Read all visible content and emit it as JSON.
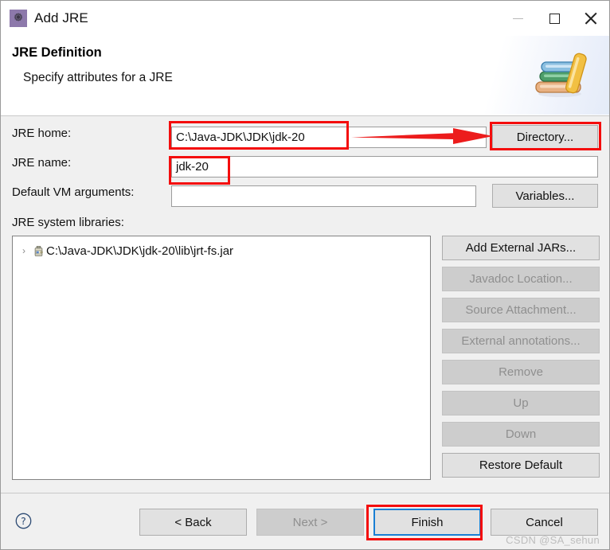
{
  "window": {
    "title": "Add JRE",
    "icon": "gear-icon",
    "controls": {
      "minimize": "—",
      "maximize": "□",
      "close": "✕"
    }
  },
  "banner": {
    "title": "JRE Definition",
    "description": "Specify attributes for a JRE",
    "image": "books-stack-image"
  },
  "form": {
    "jre_home": {
      "label": "JRE home:",
      "value": "C:\\Java-JDK\\JDK\\jdk-20",
      "placeholder": ""
    },
    "jre_name": {
      "label": "JRE name:",
      "value": "jdk-20",
      "placeholder": ""
    },
    "vm_args": {
      "label": "Default VM arguments:",
      "value": "",
      "placeholder": ""
    },
    "directory_button": "Directory...",
    "variables_button": "Variables..."
  },
  "libraries": {
    "label": "JRE system libraries:",
    "items": [
      {
        "text": "C:\\Java-JDK\\JDK\\jdk-20\\lib\\jrt-fs.jar",
        "icon": "jar-icon",
        "expander": "›"
      }
    ],
    "buttons": [
      {
        "label": "Add External JARs...",
        "enabled": true
      },
      {
        "label": "Javadoc Location...",
        "enabled": false
      },
      {
        "label": "Source Attachment...",
        "enabled": false
      },
      {
        "label": "External annotations...",
        "enabled": false
      },
      {
        "label": "Remove",
        "enabled": false
      },
      {
        "label": "Up",
        "enabled": false
      },
      {
        "label": "Down",
        "enabled": false
      },
      {
        "label": "Restore Default",
        "enabled": true
      }
    ]
  },
  "footer": {
    "help_icon": "help-question-icon",
    "back_label": "< Back",
    "next_label": "Next >",
    "finish_label": "Finish",
    "cancel_label": "Cancel",
    "next_enabled": false,
    "finish_focused": true,
    "watermark": "CSDN @SA_sehun"
  },
  "annotations": {
    "color": "#f40d0d",
    "focus_color": "#1a7fd4",
    "boxes": [
      "jre-home-field",
      "jre-name-field",
      "directory-button",
      "finish-button"
    ],
    "arrow": "points from JRE home field to Directory button"
  }
}
